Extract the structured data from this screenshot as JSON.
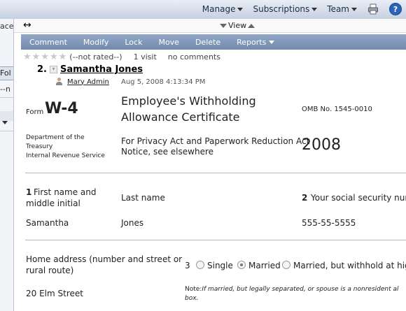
{
  "topnav": {
    "manage": "Manage",
    "subscriptions": "Subscriptions",
    "team": "Team"
  },
  "leftbg": {
    "t1": "aces",
    "tab": "Fol",
    "t2": "--n"
  },
  "panel": {
    "resize_glyph": "↔",
    "view_label": "View"
  },
  "menu": {
    "comment": "Comment",
    "modify": "Modify",
    "lock": "Lock",
    "move": "Move",
    "delete": "Delete",
    "reports": "Reports"
  },
  "meta": {
    "rating": "(--not rated--)",
    "visits": "1 visit",
    "comments": "no comments"
  },
  "entry": {
    "number": "2.",
    "title": "Samantha Jones",
    "author": "Mary Admin",
    "date": "Aug 5, 2008 4:13:34 PM"
  },
  "form": {
    "form_word": "Form",
    "form_code": "W-4",
    "title1": "Employee's Withholding",
    "title2": "Allowance Certificate",
    "omb": "OMB No. 1545-0010",
    "dept1": "Department of the",
    "dept2": "Treasury",
    "dept3": "Internal Revenue Service",
    "privacy1": "For Privacy Act and Paperwork Reduction Act",
    "privacy2": "Notice, see elsewhere",
    "year": "2008",
    "num1": "1",
    "first_label1": "First name and",
    "first_label2": "middle initial",
    "last_label": "Last name",
    "num2": "2",
    "ssn_label": "Your social security num",
    "first_value": "Samantha",
    "last_value": "Jones",
    "ssn_value": "555-55-5555",
    "addr_label1": "Home address (number and street or",
    "addr_label2": "rural route)",
    "num3": "3",
    "opt_single": "Single",
    "opt_married": "Married",
    "opt_married_higher": "Married, but withhold at highe",
    "addr_value": "20 Elm Street",
    "note_lead": "Note:",
    "note_text": "If married, but legally separated, or spouse is a nonresident al",
    "note_tail": "box."
  }
}
